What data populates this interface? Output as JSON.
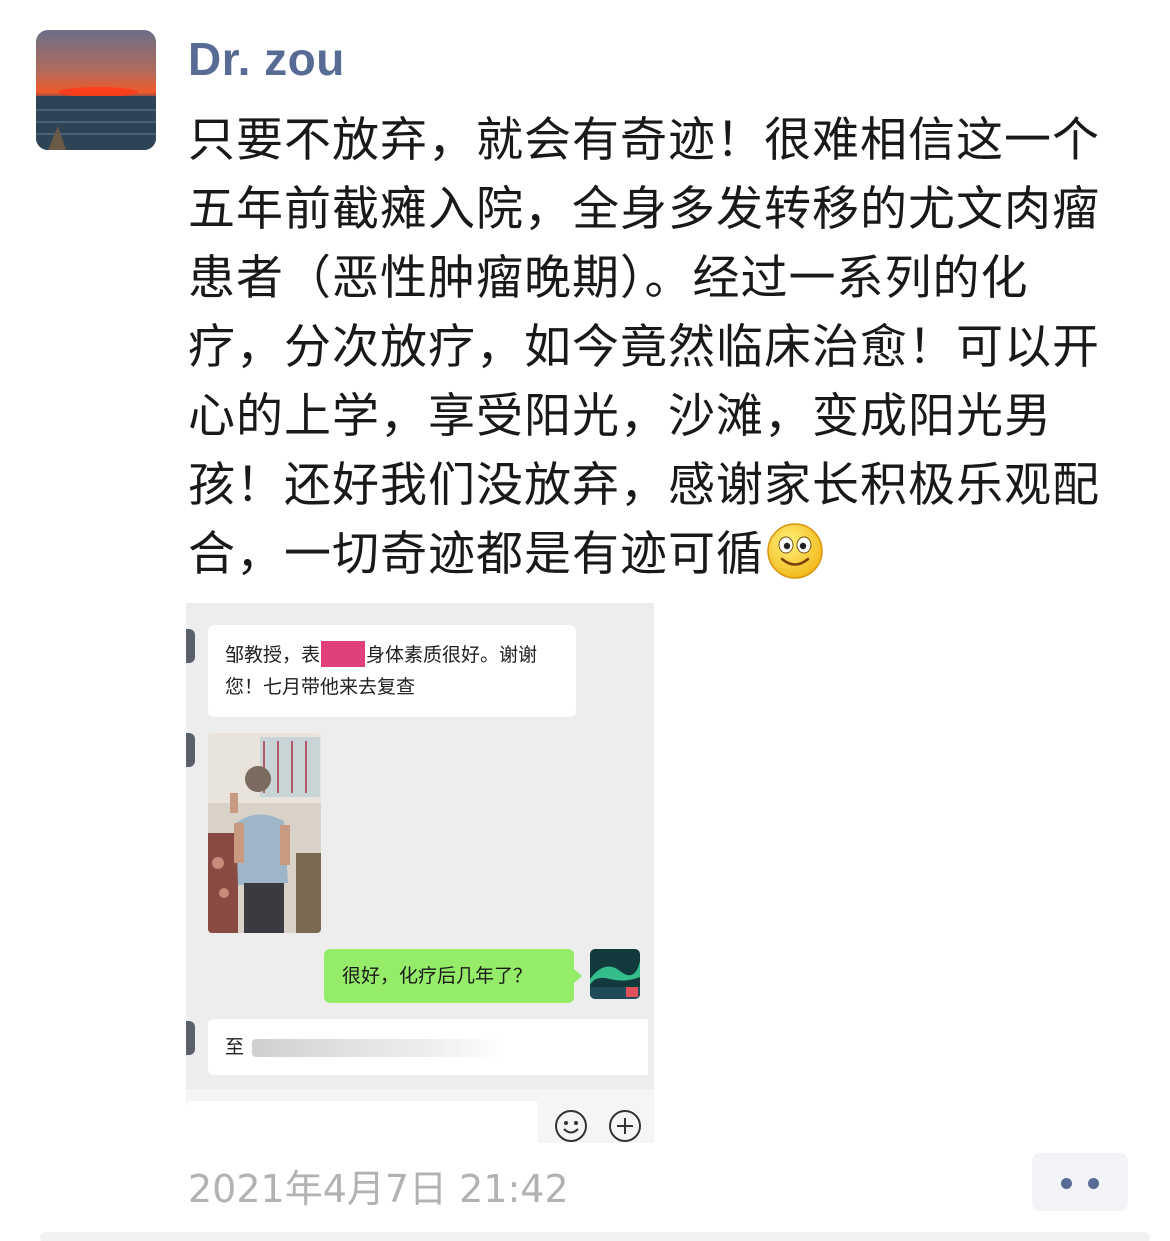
{
  "post": {
    "author": "Dr.  zou",
    "text": "只要不放弃，就会有奇迹！很难相信这一个五年前截瘫入院，全身多发转移的尤文肉瘤患者（恶性肿瘤晚期）。经过一系列的化疗，分次放疗，如今竟然临床治愈！可以开心的上学，享受阳光，沙滩，变成阳光男孩！还好我们没放弃，感谢家长积极乐观配合，一切奇迹都是有迹可循",
    "emoji": "smile-emoji",
    "timestamp": "2021年4月7日 21:42"
  },
  "chat_screenshot": {
    "message1_before": "邹教授，表",
    "message1_after": "身体素质很好。谢谢您！七月带他来去复查",
    "message2": "很好，化疗后几年了？",
    "message3": "至"
  },
  "icons": {
    "avatar": "sunset-sea-avatar",
    "more": "more-dots-icon",
    "emoji_btn": "emoji-face-icon",
    "plus_btn": "plus-circle-icon"
  }
}
